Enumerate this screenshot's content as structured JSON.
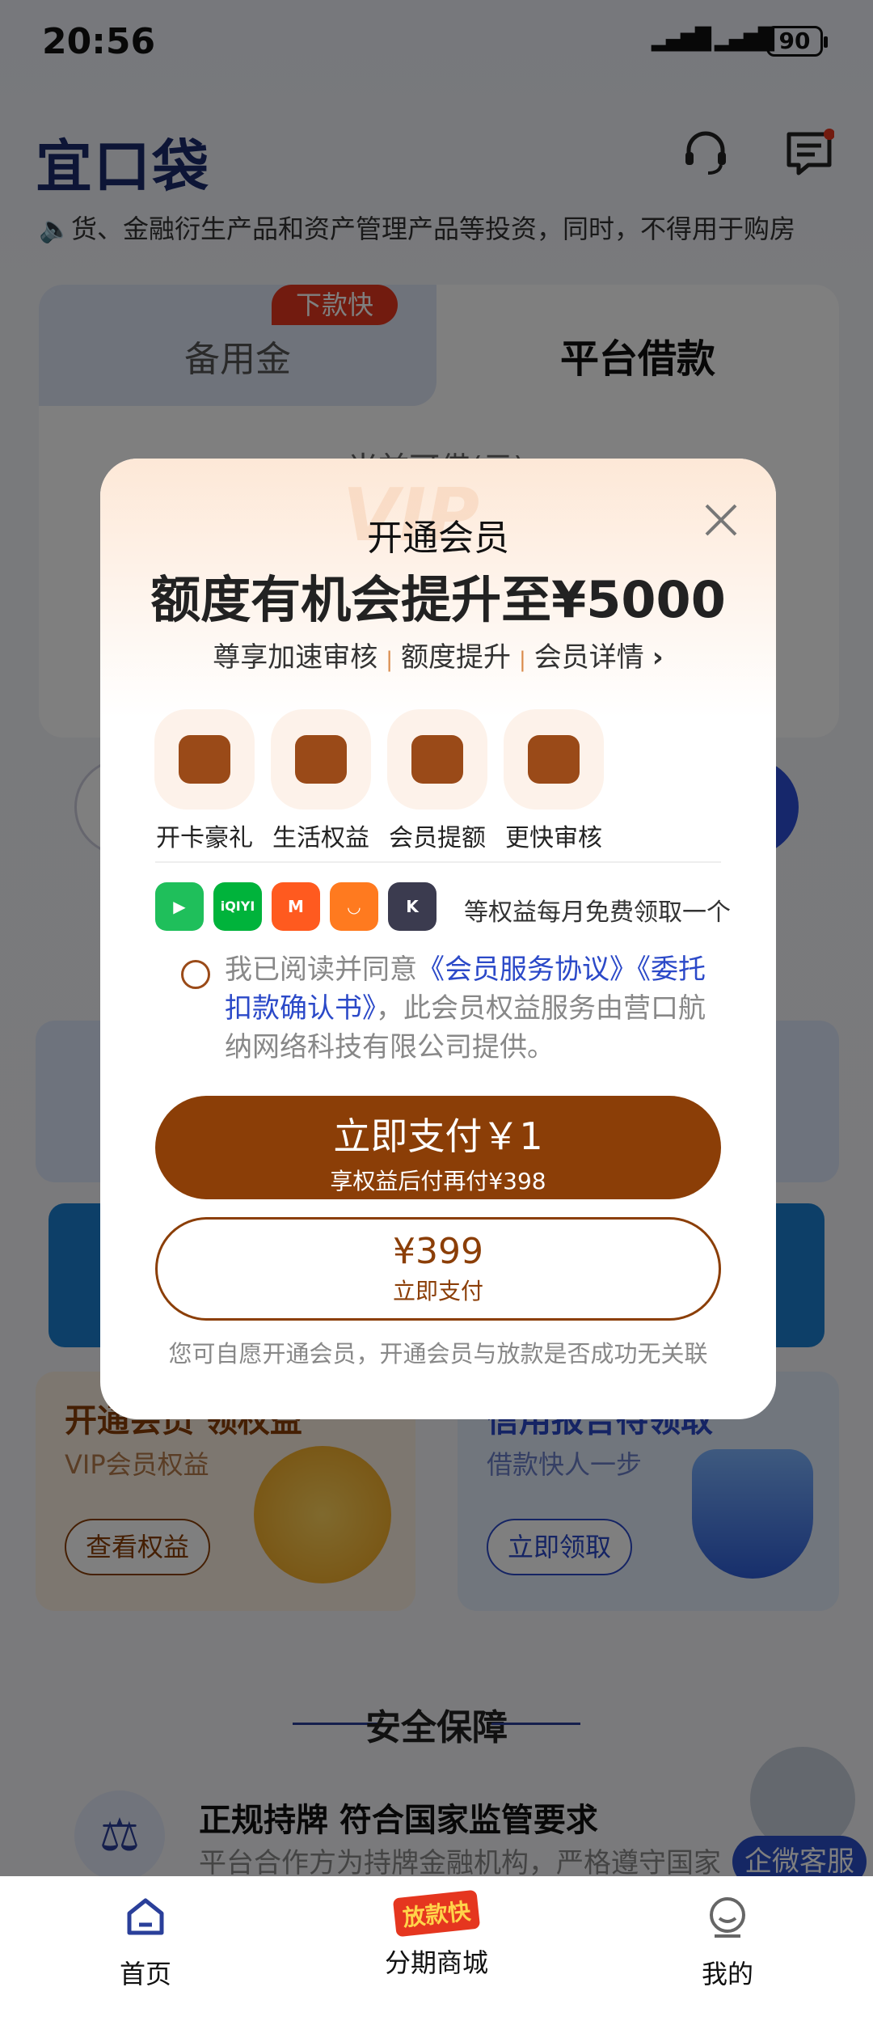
{
  "status": {
    "time": "20:56",
    "battery": "90"
  },
  "header": {
    "logo": "宜口袋",
    "notice": "货、金融衍生产品和资产管理产品等投资，同时，不得用于购房"
  },
  "card": {
    "tab_left": "备用金",
    "tab_left_tag": "下款快",
    "tab_right": "平台借款",
    "subtitle": "当前可借(元)"
  },
  "promos": [
    {
      "title": "开通会员 领权益",
      "subtitle": "VIP会员权益",
      "button": "查看权益",
      "color": "#8b3e07"
    },
    {
      "title": "信用报告待领取",
      "subtitle": "借款快人一步",
      "button": "立即领取",
      "color": "#2b49c8"
    }
  ],
  "security": {
    "title": "安全保障",
    "item_title": "正规持牌 符合国家监管要求",
    "item_sub": "平台合作方为持牌金融机构，严格遵守国家",
    "service_label": "企微客服"
  },
  "tabbar": [
    {
      "label": "首页",
      "icon": "home-icon"
    },
    {
      "label": "分期商城",
      "badge": "放款快",
      "icon": "fangkuankuai-icon"
    },
    {
      "label": "我的",
      "icon": "profile-icon"
    }
  ],
  "modal": {
    "watermark": "VIP",
    "title": "开通会员",
    "headline": "额度有机会提升至¥5000",
    "features": [
      "尊享加速审核",
      "额度提升",
      "会员详情"
    ],
    "benefits": [
      {
        "label": "开卡豪礼",
        "icon": "card-icon"
      },
      {
        "label": "生活权益",
        "icon": "video-icon"
      },
      {
        "label": "会员提额",
        "icon": "coupon-icon"
      },
      {
        "label": "更快审核",
        "icon": "review-icon"
      }
    ],
    "apps_text": "等权益每月免费领取一个",
    "apps": [
      {
        "name": "tencent-video-icon",
        "text": "▶",
        "color": "#1fbf5b"
      },
      {
        "name": "iqiyi-icon",
        "text": "iQIYI",
        "color": "#00b33b"
      },
      {
        "name": "mango-tv-icon",
        "text": "M",
        "color": "#ff5a1f"
      },
      {
        "name": "youku-icon",
        "text": "◡",
        "color": "#ff7a1f"
      },
      {
        "name": "kuke-icon",
        "text": "K",
        "color": "#3b3b4f"
      }
    ],
    "agreement_prefix": "我已阅读并同意",
    "agreement_link1": "《会员服务协议》",
    "agreement_link2": "《委托扣款确认书》",
    "agreement_suffix": "，此会员权益服务由营口航纳网络科技有限公司提供。",
    "pay_primary": "立即支付￥1",
    "pay_primary_sub": "享权益后付再付¥398",
    "pay_secondary": "¥399",
    "pay_secondary_sub": "立即支付",
    "disclaimer": "您可自愿开通会员，开通会员与放款是否成功无关联"
  },
  "colors": {
    "accent": "#8b3e07",
    "brand": "#1a2a6c",
    "link": "#2b49c8"
  }
}
